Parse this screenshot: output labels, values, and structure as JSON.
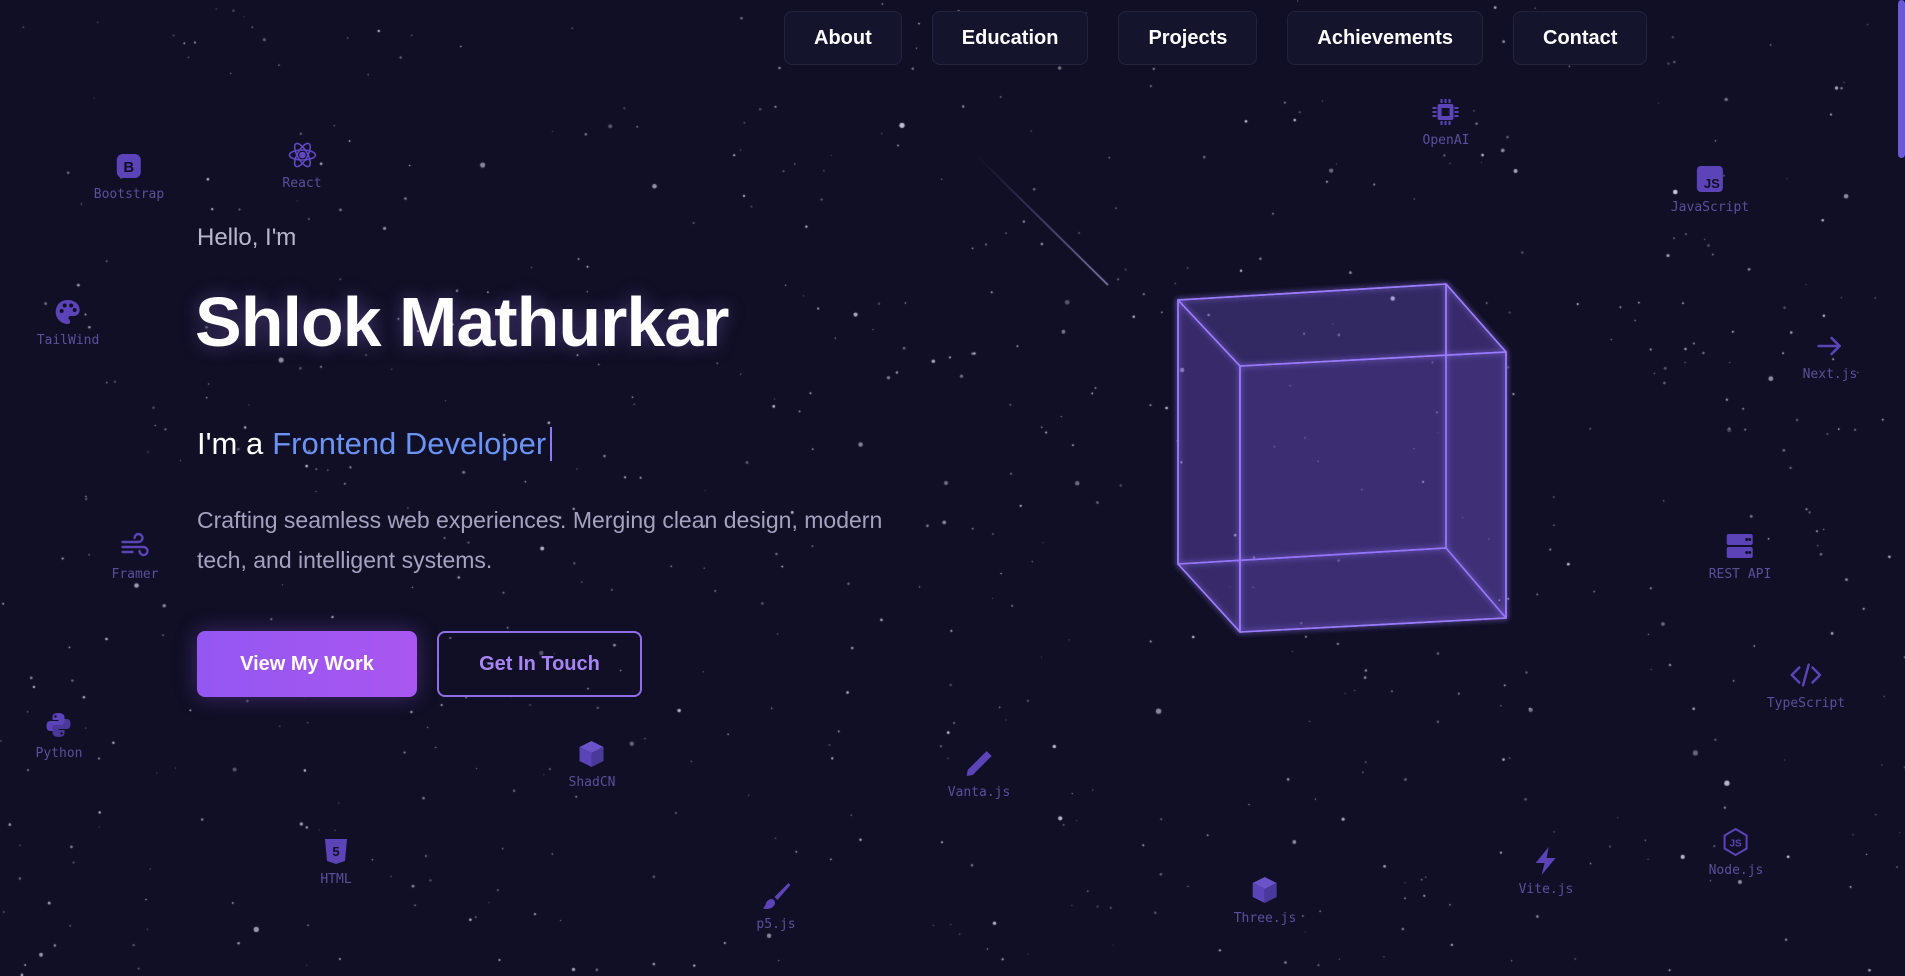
{
  "colors": {
    "background": "#100f25",
    "accent": "#9b5cf5",
    "highlight": "#6a93f5"
  },
  "nav": {
    "items": [
      "About",
      "Education",
      "Projects",
      "Achievements",
      "Contact"
    ]
  },
  "hero": {
    "greeting": "Hello, I'm",
    "name": "Shlok Mathurkar",
    "role_prefix": "I'm a",
    "role_highlight": "Frontend Developer",
    "description": "Crafting seamless web experiences. Merging clean design, modern tech, and intelligent systems.",
    "primary_button": "View My Work",
    "secondary_button": "Get In Touch"
  },
  "tech_icons": [
    {
      "label": "Bootstrap",
      "icon": "bootstrap-icon"
    },
    {
      "label": "React",
      "icon": "react-icon"
    },
    {
      "label": "TailWind",
      "icon": "palette-icon"
    },
    {
      "label": "Framer",
      "icon": "wind-icon"
    },
    {
      "label": "Python",
      "icon": "python-icon"
    },
    {
      "label": "HTML",
      "icon": "html5-icon"
    },
    {
      "label": "ShadCN",
      "icon": "box-icon"
    },
    {
      "label": "p5.js",
      "icon": "brush-icon"
    },
    {
      "label": "Vanta.js",
      "icon": "pen-icon"
    },
    {
      "label": "Three.js",
      "icon": "cube-icon"
    },
    {
      "label": "OpenAI",
      "icon": "chip-icon"
    },
    {
      "label": "JavaScript",
      "icon": "javascript-icon"
    },
    {
      "label": "Next.js",
      "icon": "arrow-right-icon"
    },
    {
      "label": "REST API",
      "icon": "server-icon"
    },
    {
      "label": "TypeScript",
      "icon": "code-icon"
    },
    {
      "label": "Vite.js",
      "icon": "bolt-icon"
    },
    {
      "label": "Node.js",
      "icon": "nodejs-icon"
    }
  ]
}
